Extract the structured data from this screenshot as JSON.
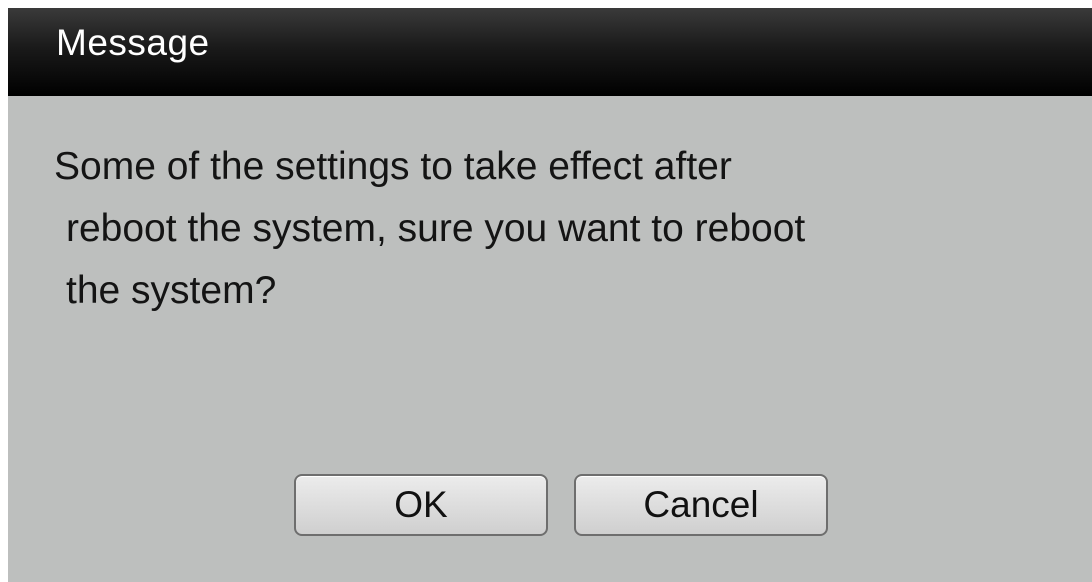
{
  "dialog": {
    "title": "Message",
    "message_lines": [
      "Some of the settings to take effect after",
      "reboot the system, sure you want to reboot",
      "the system?"
    ],
    "ok_label": "OK",
    "cancel_label": "Cancel"
  },
  "colors": {
    "title_bar": "#000000",
    "dialog_background": "#bdbfbe",
    "button_background": "#dcdcdc"
  }
}
